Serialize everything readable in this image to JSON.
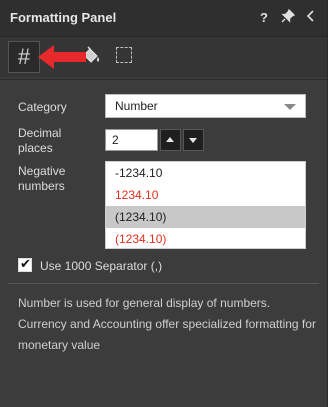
{
  "header": {
    "title": "Formatting Panel",
    "help_icon": "?",
    "pin_icon": "pin-icon",
    "collapse_icon": "chevron-left-icon"
  },
  "toolbar": {
    "number_tool": "#",
    "fill_tool_icon": "paint-bucket-icon",
    "border_tool_icon": "dashed-border-icon",
    "annotation_color": "#e8292b"
  },
  "form": {
    "category_label": "Category",
    "category_value": "Number",
    "decimal_label": "Decimal places",
    "decimal_value": "2",
    "negative_label": "Negative numbers",
    "negative_options": [
      {
        "text": "-1234.10",
        "color": "#222222",
        "selected": false
      },
      {
        "text": "1234.10",
        "color": "#e0301e",
        "selected": false
      },
      {
        "text": "(1234.10)",
        "color": "#222222",
        "selected": true
      },
      {
        "text": "(1234.10)",
        "color": "#e0301e",
        "selected": false
      }
    ],
    "separator_label": "Use 1000 Separator (,)",
    "separator_checked": true
  },
  "description": "Number is used for general display of numbers. Currency and Accounting offer specialized formatting for monetary value"
}
